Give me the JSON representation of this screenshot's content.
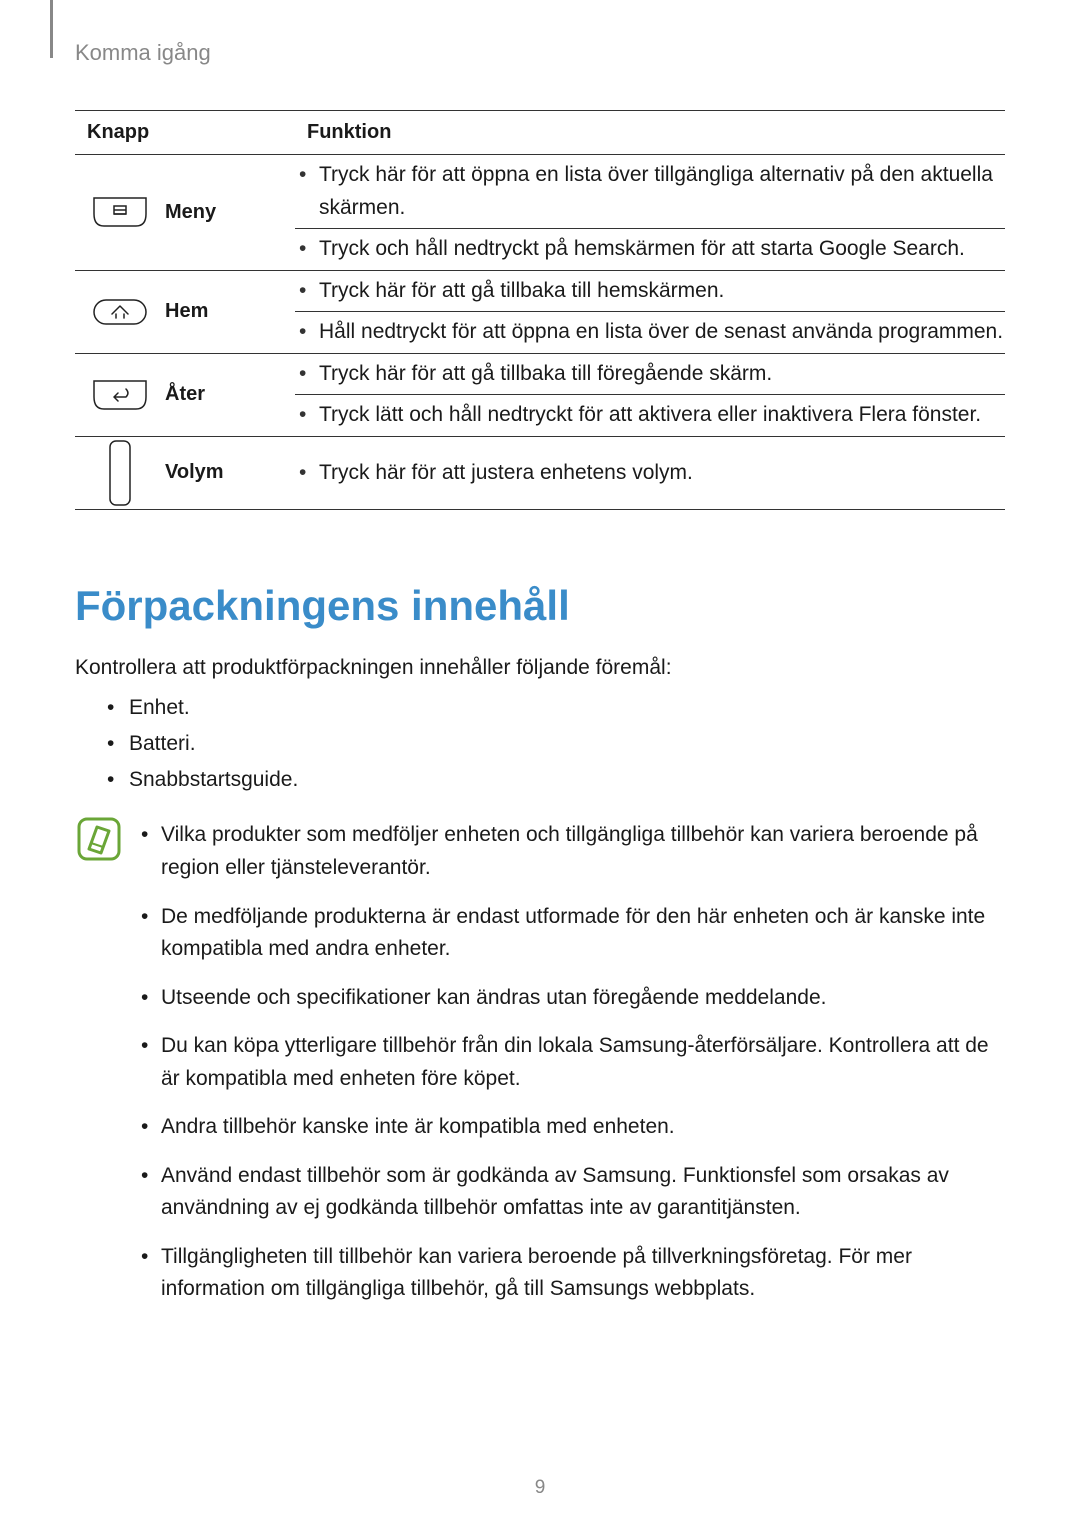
{
  "breadcrumb": "Komma igång",
  "table": {
    "header": {
      "button": "Knapp",
      "function": "Funktion"
    },
    "rows": [
      {
        "name": "Meny",
        "icon": "menu-key-icon",
        "items": [
          "Tryck här för att öppna en lista över tillgängliga alternativ på den aktuella skärmen.",
          "Tryck och håll nedtryckt på hemskärmen för att starta Google Search."
        ]
      },
      {
        "name": "Hem",
        "icon": "home-key-icon",
        "items": [
          "Tryck här för att gå tillbaka till hemskärmen.",
          "Håll nedtryckt för att öppna en lista över de senast använda programmen."
        ]
      },
      {
        "name": "Åter",
        "icon": "back-key-icon",
        "items": [
          "Tryck här för att gå tillbaka till föregående skärm.",
          "Tryck lätt och håll nedtryckt för att aktivera eller inaktivera Flera fönster."
        ]
      },
      {
        "name": "Volym",
        "icon": "volume-key-icon",
        "items": [
          "Tryck här för att justera enhetens volym."
        ]
      }
    ]
  },
  "heading": "Förpackningens innehåll",
  "intro": "Kontrollera att produktförpackningen innehåller följande föremål:",
  "package_items": [
    "Enhet.",
    "Batteri.",
    "Snabbstartsguide."
  ],
  "notes": [
    "Vilka produkter som medföljer enheten och tillgängliga tillbehör kan variera beroende på region eller tjänsteleverantör.",
    "De medföljande produkterna är endast utformade för den här enheten och är kanske inte kompatibla med andra enheter.",
    "Utseende och specifikationer kan ändras utan föregående meddelande.",
    "Du kan köpa ytterligare tillbehör från din lokala Samsung-återförsäljare. Kontrollera att de är kompatibla med enheten före köpet.",
    "Andra tillbehör kanske inte är kompatibla med enheten.",
    "Använd endast tillbehör som är godkända av Samsung. Funktionsfel som orsakas av användning av ej godkända tillbehör omfattas inte av garantitjänsten.",
    "Tillgängligheten till tillbehör kan variera beroende på tillverkningsföretag. För mer information om tillgängliga tillbehör, gå till Samsungs webbplats."
  ],
  "page_number": "9"
}
